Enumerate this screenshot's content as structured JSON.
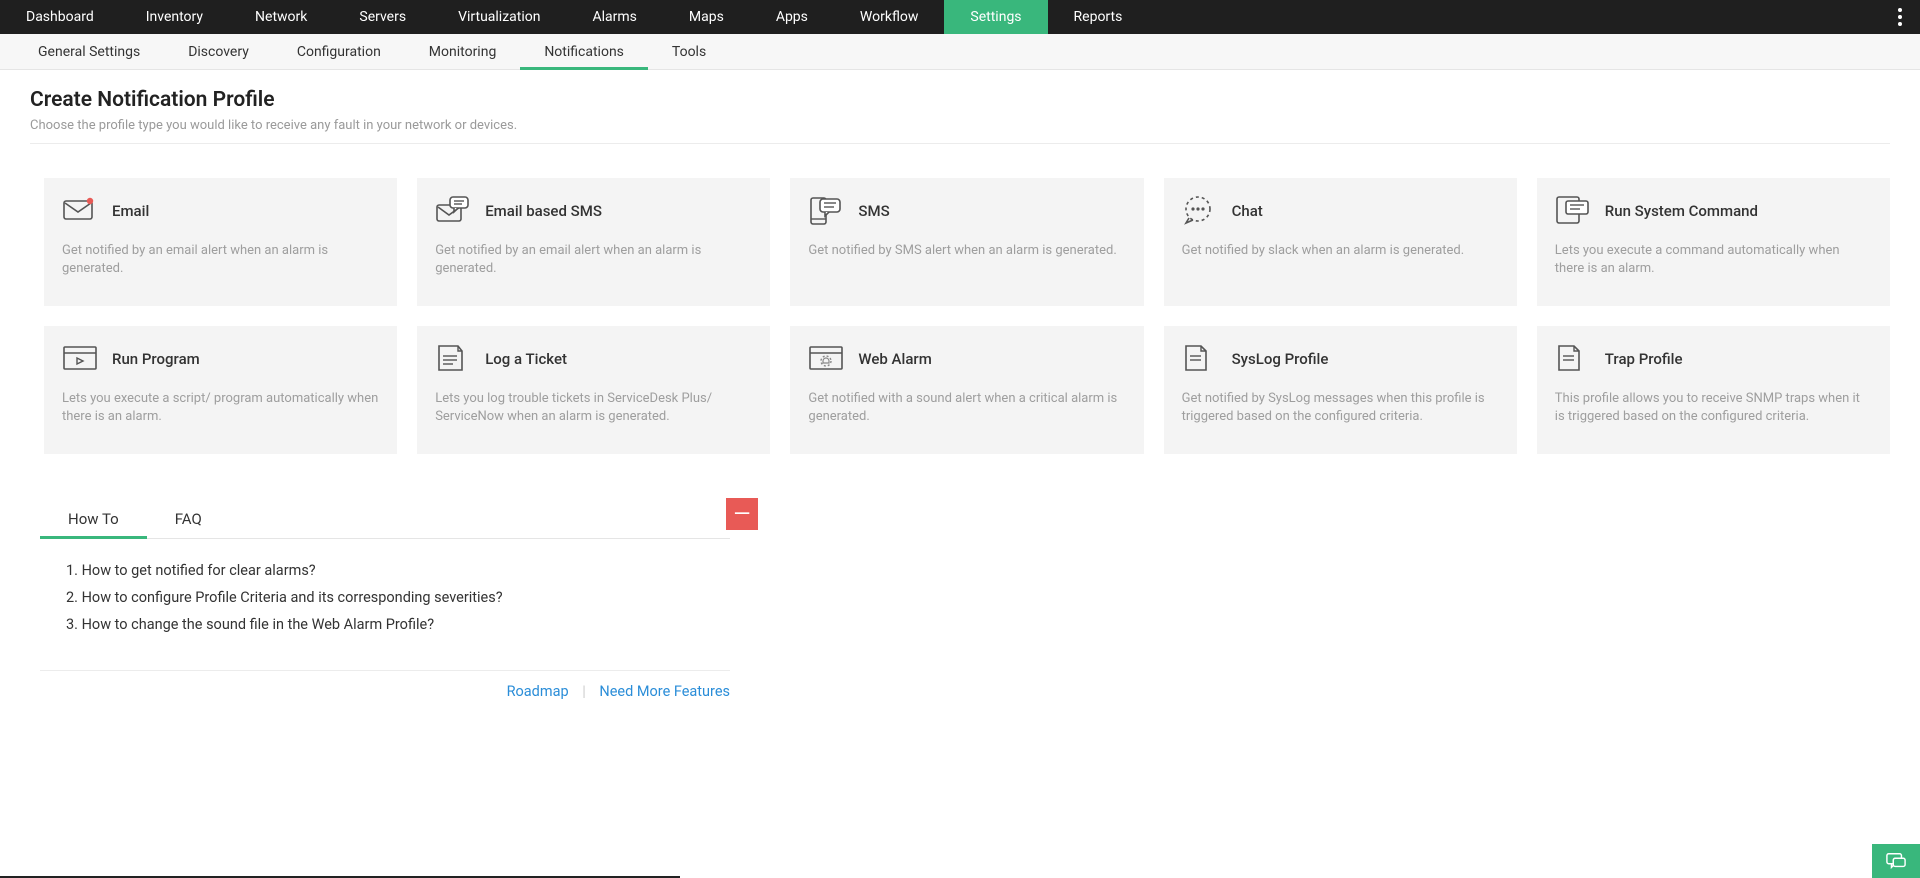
{
  "topnav": {
    "items": [
      {
        "label": "Dashboard"
      },
      {
        "label": "Inventory"
      },
      {
        "label": "Network"
      },
      {
        "label": "Servers"
      },
      {
        "label": "Virtualization"
      },
      {
        "label": "Alarms"
      },
      {
        "label": "Maps"
      },
      {
        "label": "Apps"
      },
      {
        "label": "Workflow"
      },
      {
        "label": "Settings",
        "active": true
      },
      {
        "label": "Reports"
      }
    ]
  },
  "subnav": {
    "items": [
      {
        "label": "General Settings"
      },
      {
        "label": "Discovery"
      },
      {
        "label": "Configuration"
      },
      {
        "label": "Monitoring"
      },
      {
        "label": "Notifications",
        "active": true
      },
      {
        "label": "Tools"
      }
    ]
  },
  "page": {
    "title": "Create Notification Profile",
    "subtitle": "Choose the profile type you would like to receive any fault in your network or devices."
  },
  "cards": [
    {
      "icon": "envelope-dot",
      "title": "Email",
      "desc": "Get notified by an email alert when an alarm is generated."
    },
    {
      "icon": "envelope-speech",
      "title": "Email based SMS",
      "desc": "Get notified by an email alert when an alarm is generated."
    },
    {
      "icon": "phone-sms",
      "title": "SMS",
      "desc": "Get notified by SMS alert when an alarm is generated."
    },
    {
      "icon": "chat",
      "title": "Chat",
      "desc": "Get notified by slack when an alarm is generated."
    },
    {
      "icon": "terminal-doc",
      "title": "Run System Command",
      "desc": "Lets you execute a command automatically when there is an alarm."
    },
    {
      "icon": "run-program",
      "title": "Run Program",
      "desc": "Lets you execute a script/ program automatically when there is an alarm."
    },
    {
      "icon": "ticket",
      "title": "Log a Ticket",
      "desc": "Lets you log trouble tickets in ServiceDesk Plus/ ServiceNow when an alarm is generated."
    },
    {
      "icon": "web-alarm",
      "title": "Web Alarm",
      "desc": "Get notified with a sound alert when a critical alarm is generated."
    },
    {
      "icon": "doc",
      "title": "SysLog Profile",
      "desc": "Get notified by SysLog messages when this profile is triggered based on the configured criteria."
    },
    {
      "icon": "doc",
      "title": "Trap Profile",
      "desc": "This profile allows you to receive SNMP traps when it is triggered based on the configured criteria."
    }
  ],
  "howto": {
    "tabs": [
      {
        "label": "How To",
        "active": true
      },
      {
        "label": "FAQ"
      }
    ],
    "items": [
      "How to get notified for clear alarms?",
      "How to configure Profile Criteria and its corresponding severities?",
      "How to change the sound file in the Web Alarm Profile?"
    ],
    "links": {
      "roadmap": "Roadmap",
      "need_more": "Need More Features"
    },
    "collapse_glyph": "—"
  }
}
